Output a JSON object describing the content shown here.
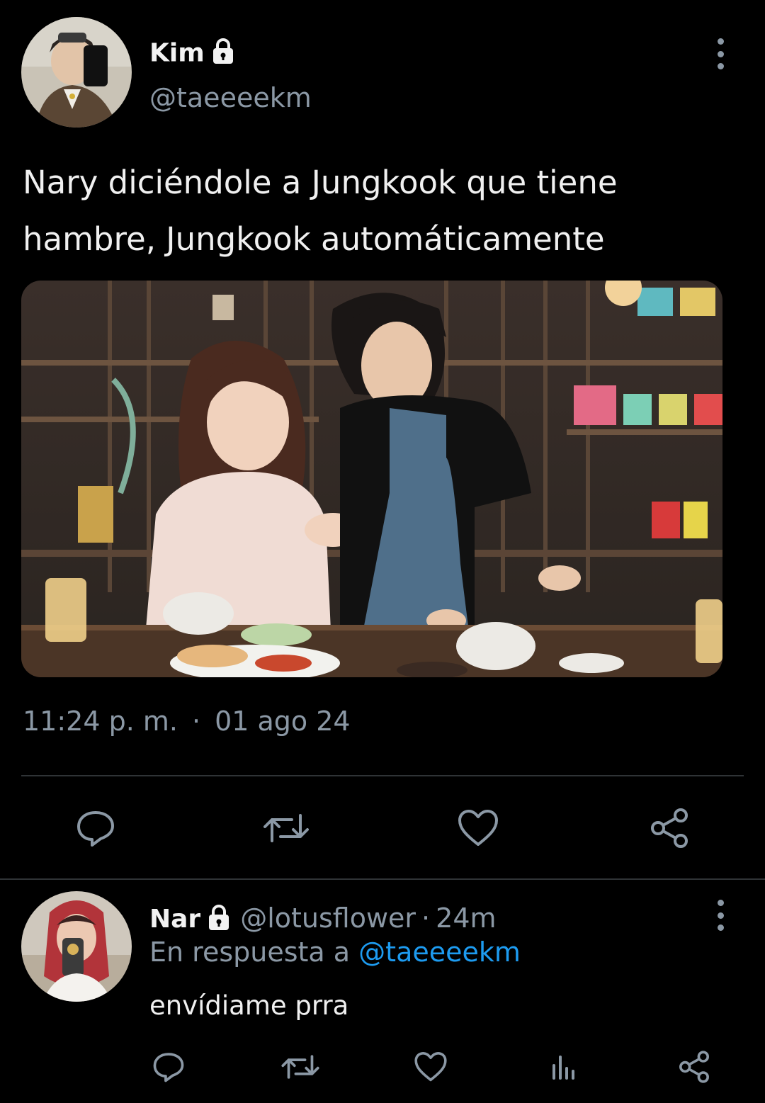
{
  "main_tweet": {
    "author_name": "Kim",
    "author_handle": "@taeeeekm",
    "text": "Nary diciéndole a Jungkook que tiene hambre, Jungkook automáticamente",
    "time": "11:24 p. m.",
    "separator": "·",
    "date": "01 ago 24",
    "actions": [
      "reply-icon",
      "retweet-icon",
      "like-icon",
      "share-icon"
    ]
  },
  "reply_tweet": {
    "author_name": "Nar",
    "author_handle": "@lotusflower",
    "time_separator": "·",
    "time_ago": "24m",
    "reply_prefix": "En respuesta a",
    "reply_mention": "@taeeeekm",
    "text": "envídiame prra",
    "actions": [
      "reply-icon",
      "retweet-icon",
      "like-icon",
      "analytics-icon",
      "share-icon"
    ]
  },
  "colors": {
    "background": "#000000",
    "text": "#e7e9ea",
    "secondary": "#8b98a5",
    "accent": "#1d9bf0",
    "divider": "#2f3336"
  }
}
